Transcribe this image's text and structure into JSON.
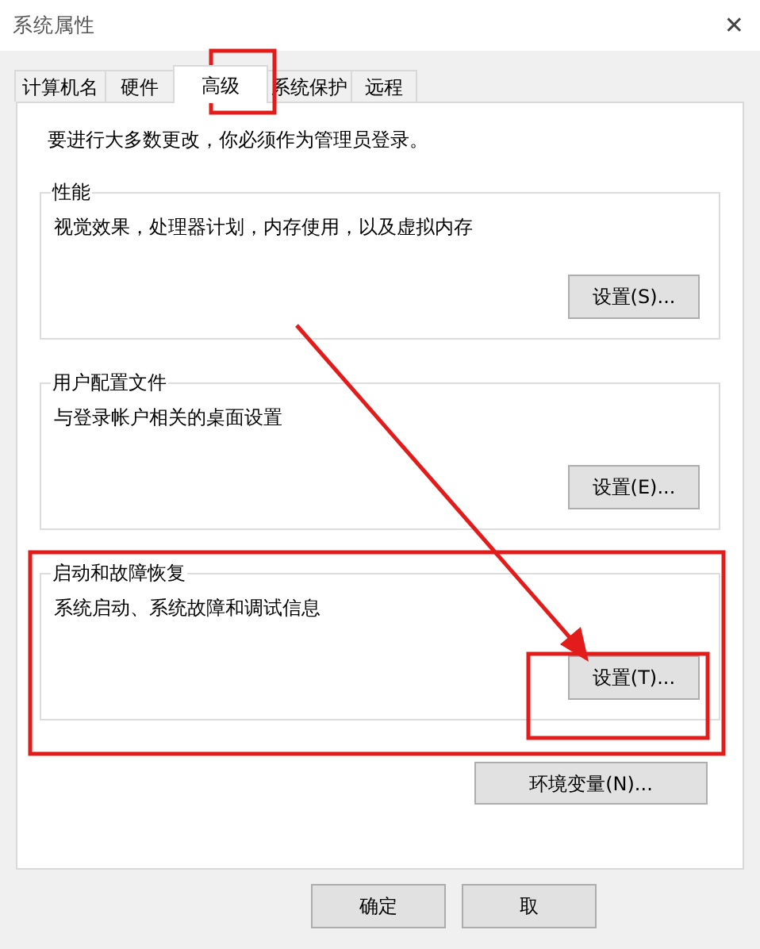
{
  "window": {
    "title": "系统属性",
    "close": "✕"
  },
  "tabs": [
    {
      "label": "计算机名",
      "selected": false
    },
    {
      "label": "硬件",
      "selected": false
    },
    {
      "label": "高级",
      "selected": true
    },
    {
      "label": "系统保护",
      "selected": false
    },
    {
      "label": "远程",
      "selected": false
    }
  ],
  "notice": "要进行大多数更改，你必须作为管理员登录。",
  "groups": [
    {
      "title": "性能",
      "description": "视觉效果，处理器计划，内存使用，以及虚拟内存",
      "button": "设置(S)..."
    },
    {
      "title": "用户配置文件",
      "description": "与登录帐户相关的桌面设置",
      "button": "设置(E)..."
    },
    {
      "title": "启动和故障恢复",
      "description": "系统启动、系统故障和调试信息",
      "button": "设置(T)..."
    }
  ],
  "env_button": "环境变量(N)...",
  "footer_buttons": [
    "确定",
    "取"
  ]
}
